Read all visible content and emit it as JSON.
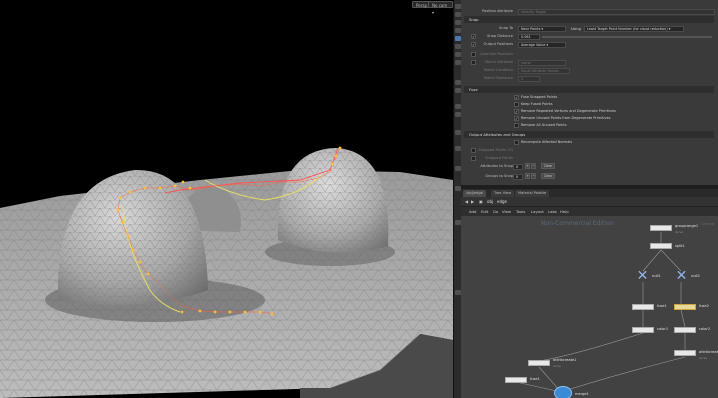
{
  "viewport": {
    "persp_label": "Persp",
    "cam_label": "No cam"
  },
  "params": {
    "top_rows": [
      {
        "label": "Position Attribute",
        "value": "Velocity Target",
        "dim": true
      }
    ],
    "snap_section": "Snap",
    "snap_to_label": "Snap To",
    "snap_to_value": "Near Points",
    "using_label": "Using",
    "using_value": "Least Target Point Number (for cloud reduction)",
    "snap_distance_label": "Snap Distance",
    "snap_distance_value": "0.061",
    "output_positions_label": "Output Positions",
    "output_positions_value": "Average Value",
    "dim_rows": [
      {
        "label": "Quantize Positions",
        "value": ""
      },
      {
        "label": "Match Attribute",
        "value": "name"
      },
      {
        "label": "Match Condition",
        "value": "Equal Attribute Values"
      },
      {
        "label": "Match Tolerance",
        "value": "0"
      }
    ],
    "fuse_section": "Fuse",
    "fuse_checks": [
      {
        "label": "Fuse Snapped Points",
        "checked": true
      },
      {
        "label": "Keep Fused Points",
        "checked": false
      },
      {
        "label": "Remove Repeated Vertices and Degenerate Primitives",
        "checked": true
      },
      {
        "label": "Remove Unused Points from Degenerate Primitives",
        "checked": true
      },
      {
        "label": "Remove All Unused Points",
        "checked": false
      }
    ],
    "output_section": "Output Attributes and Groups",
    "recompute_label": "Recompute Affected Normals",
    "snapped_points_label": "Snapped Points (G)",
    "snapped_points2_label": "Snapped Points",
    "attrs_to_snap_label": "Attributes to Snap",
    "attrs_to_snap_value": "0",
    "groups_to_snap_label": "Groups to Snap",
    "groups_to_snap_value": "0",
    "clear_label": "Clear"
  },
  "network": {
    "tabs": [
      "/obj/edge",
      "Tree View",
      "Material Palette"
    ],
    "path": "edge",
    "menus": [
      "Add",
      "Edit",
      "Go",
      "View",
      "Tools",
      "Layout",
      "Labs",
      "Help"
    ],
    "watermark": "Non-Commercial Edition",
    "corner_label": "Geome",
    "nodes": {
      "grouprange1": {
        "name": "grouprange1",
        "sub": "curve"
      },
      "split1": {
        "name": "split1",
        "sub": ""
      },
      "null1": {
        "name": "null1",
        "sub": ""
      },
      "null2": {
        "name": "null2",
        "sub": ""
      },
      "fuse1": {
        "name": "fuse1",
        "sub": ""
      },
      "fuse2": {
        "name": "fuse2",
        "sub": ""
      },
      "color1": {
        "name": "color1",
        "sub": ""
      },
      "color2": {
        "name": "color2",
        "sub": ""
      },
      "attribcreate1": {
        "name": "attribcreate1",
        "sub": "curve"
      },
      "attribcreate2": {
        "name": "attribcreate2",
        "sub": "curve"
      },
      "fuse3": {
        "name": "fuse1",
        "sub": ""
      },
      "merge1": {
        "name": "merge1",
        "sub": ""
      }
    }
  },
  "colors": {
    "accent_yellow": "#ffcc33",
    "curve_red": "#ff5555",
    "curve_yellow": "#f0e060",
    "null_blue": "#8fb5e6",
    "merge_blue": "#3a8ad8"
  }
}
